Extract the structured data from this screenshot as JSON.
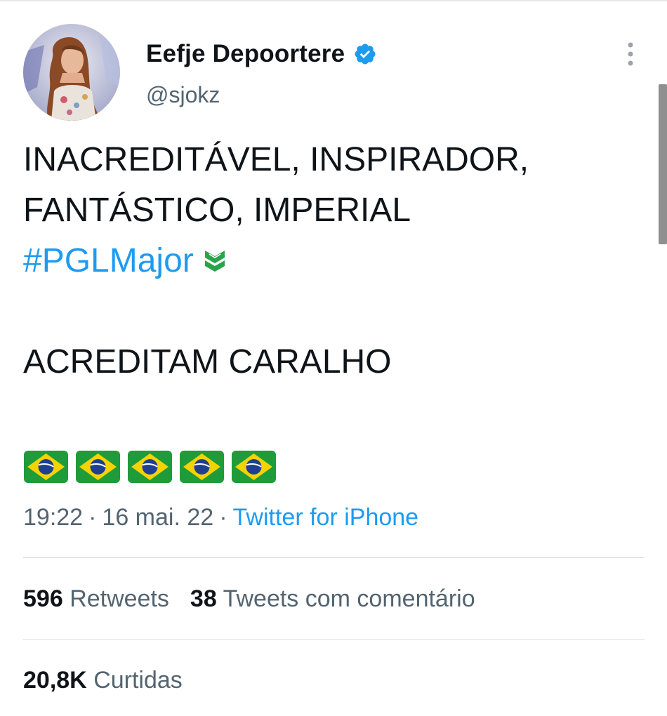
{
  "author": {
    "display_name": "Eefje Depoortere",
    "handle": "@sjokz",
    "verified": true,
    "verified_icon": "verified-badge-icon"
  },
  "tweet": {
    "lines": [
      "INACREDITÁVEL, INSPIRADOR,",
      "FANTÁSTICO, IMPERIAL"
    ],
    "hashtag": "#PGLMajor",
    "hashtag_emoji": "pgl-major-icon",
    "line_after": "ACREDITAM CARALHO",
    "flags": [
      "brazil-flag-icon",
      "brazil-flag-icon",
      "brazil-flag-icon",
      "brazil-flag-icon",
      "brazil-flag-icon"
    ]
  },
  "meta": {
    "time": "19:22",
    "separator": "·",
    "date": "16 mai. 22",
    "source": "Twitter for iPhone"
  },
  "stats": {
    "retweets_count": "596",
    "retweets_label": "Retweets",
    "quotes_count": "38",
    "quotes_label": "Tweets com comentário",
    "likes_count": "20,8K",
    "likes_label": "Curtidas"
  },
  "colors": {
    "text": "#0f1419",
    "secondary": "#536471",
    "link": "#1d9bf0",
    "divider": "#dadada",
    "pgl_green": "#2aa34a",
    "flag_green": "#1f9b3a",
    "flag_yellow": "#f5d300",
    "flag_blue": "#1f3f8f"
  }
}
